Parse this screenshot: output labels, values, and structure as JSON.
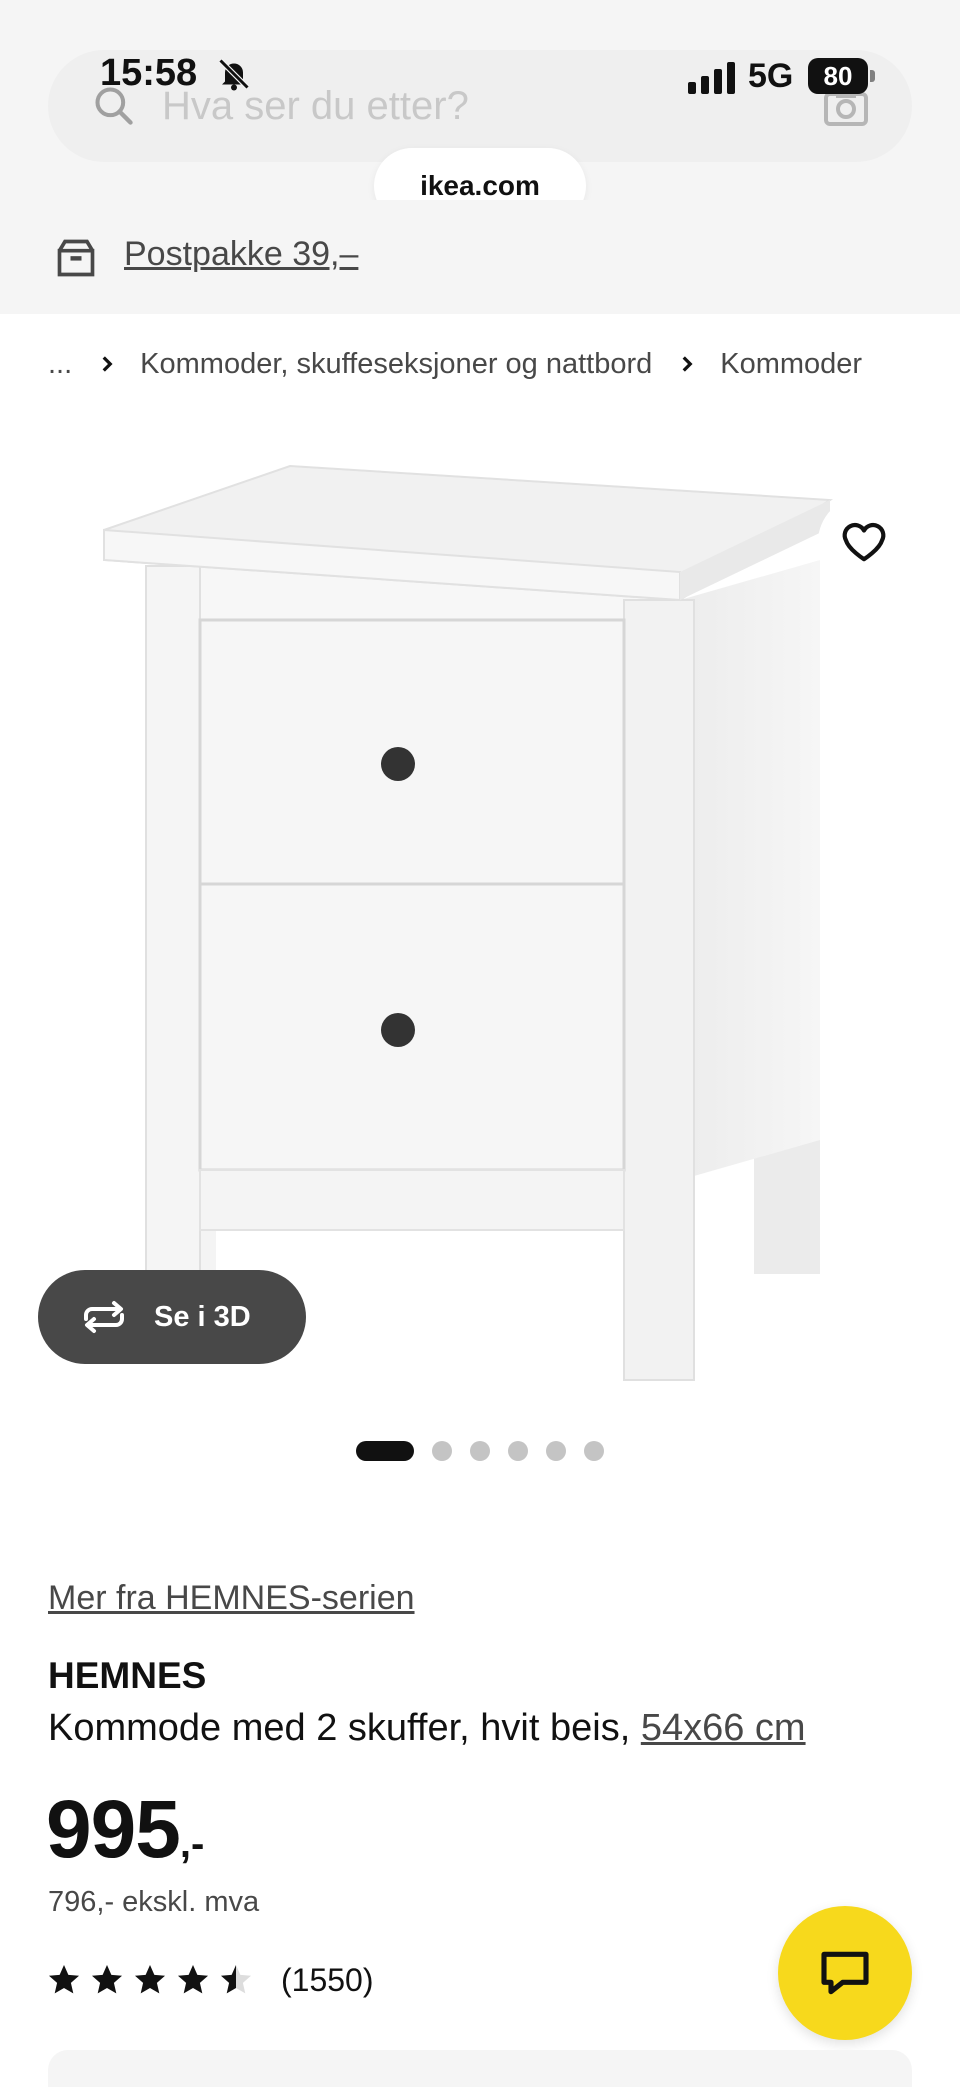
{
  "status_bar": {
    "time": "15:58",
    "network": "5G",
    "battery": "80"
  },
  "search": {
    "placeholder": "Hva ser du etter?"
  },
  "browser": {
    "url": "ikea.com"
  },
  "delivery": {
    "label": "Postpakke 39,–"
  },
  "breadcrumb": {
    "ellipsis": "...",
    "items": [
      "Kommoder, skuffeseksjoner og nattbord",
      "Kommoder"
    ]
  },
  "gallery": {
    "view_3d_label": "Se i 3D",
    "total_images": 6,
    "active_index": 0
  },
  "product": {
    "series_link": "Mer fra HEMNES-serien",
    "name": "HEMNES",
    "description": "Kommode med 2 skuffer, hvit beis,",
    "size": "54x66 cm",
    "price_integer": "995",
    "price_suffix": ",-",
    "price_ex_vat": "796,- ekskl. mva",
    "rating": 4.5,
    "review_count": "(1550)"
  },
  "colors": {
    "accent_yellow": "#f7d91c",
    "text_dark": "#111111",
    "text_grey": "#484848",
    "background_grey": "#f5f5f5"
  },
  "icons": [
    "search-icon",
    "camera-icon",
    "bell-slash-icon",
    "signal-icon",
    "box-icon",
    "chevron-right-icon",
    "heart-icon",
    "rotate-3d-icon",
    "star-icon",
    "chat-icon"
  ]
}
